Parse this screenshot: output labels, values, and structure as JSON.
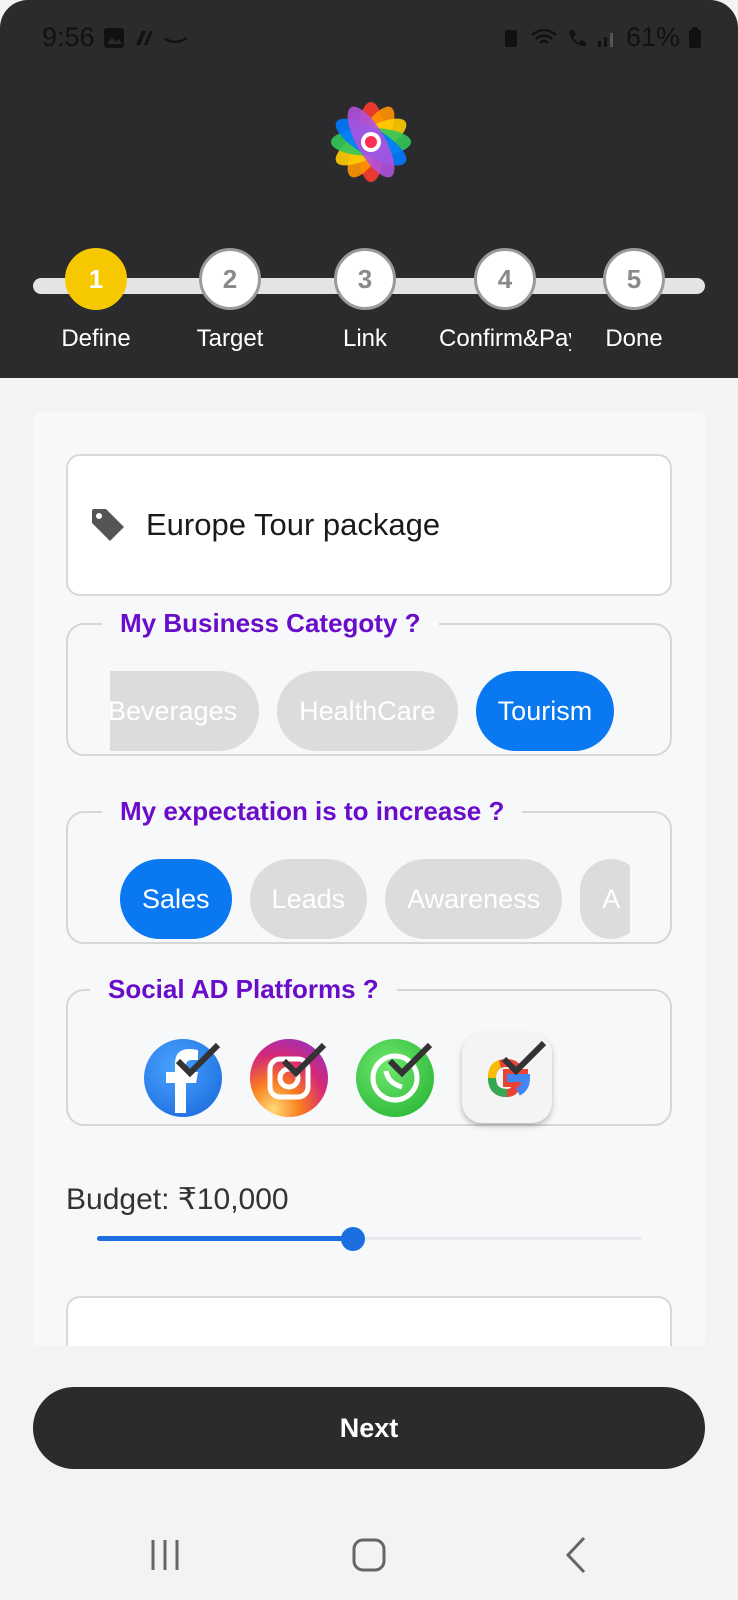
{
  "status_bar": {
    "time": "9:56",
    "battery": "61%"
  },
  "steps": [
    {
      "number": "1",
      "label": "Define"
    },
    {
      "number": "2",
      "label": "Target"
    },
    {
      "number": "3",
      "label": "Link"
    },
    {
      "number": "4",
      "label": "Confirm&Pay"
    },
    {
      "number": "5",
      "label": "Done"
    }
  ],
  "ad_title": {
    "value": "Europe Tour package"
  },
  "business_category": {
    "legend": "My Business Categoty ?",
    "options": [
      "Beverages",
      "HealthCare",
      "Tourism"
    ],
    "selected": "Tourism"
  },
  "expectation": {
    "legend": "My expectation is to increase ?",
    "options": [
      "Sales",
      "Leads",
      "Awareness",
      "A"
    ],
    "selected": "Sales"
  },
  "platforms": {
    "legend": "Social AD Platforms ?",
    "items": [
      "facebook-icon",
      "instagram-icon",
      "whatsapp-icon",
      "google-icon"
    ]
  },
  "budget": {
    "label": "Budget: ₹10,000",
    "fraction": 0.47
  },
  "next_button": {
    "label": "Next"
  },
  "colors": {
    "accent": "#0a78f0",
    "legend": "#6a0dca",
    "step_active": "#f5c800",
    "header": "#2b2b2d"
  }
}
